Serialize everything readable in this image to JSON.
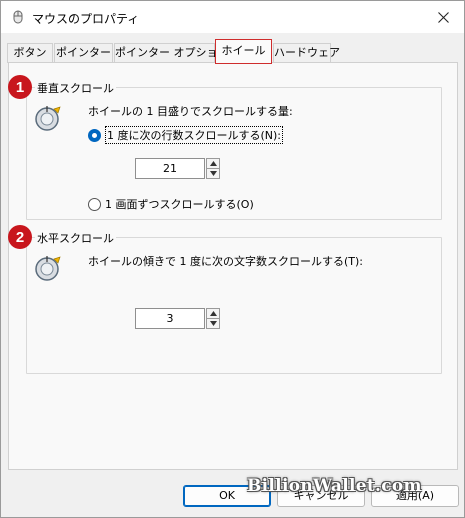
{
  "window": {
    "title": "マウスのプロパティ",
    "close_label": "✕"
  },
  "tabs": [
    {
      "label": "ボタン",
      "active": false
    },
    {
      "label": "ポインター",
      "active": false
    },
    {
      "label": "ポインター オプション",
      "active": false
    },
    {
      "label": "ホイール",
      "active": true
    },
    {
      "label": "ハードウェア",
      "active": false
    }
  ],
  "vertical": {
    "badge": "1",
    "title": "垂直スクロール",
    "prompt": "ホイールの 1 目盛りでスクロールする量:",
    "option_lines_label": "1 度に次の行数スクロールする(N):",
    "option_lines_selected": true,
    "lines_value": "21",
    "option_screen_label": "1 画面ずつスクロールする(O)",
    "option_screen_selected": false
  },
  "horizontal": {
    "badge": "2",
    "title": "水平スクロール",
    "prompt": "ホイールの傾きで 1 度に次の文字数スクロールする(T):",
    "chars_value": "3"
  },
  "buttons": {
    "ok": "OK",
    "cancel": "キャンセル",
    "apply": "適用(A)"
  },
  "watermark": "BillionWallet.com",
  "colors": {
    "accent": "#0067c0",
    "badge": "#c8161d",
    "tab_highlight": "#cf2d2d"
  }
}
